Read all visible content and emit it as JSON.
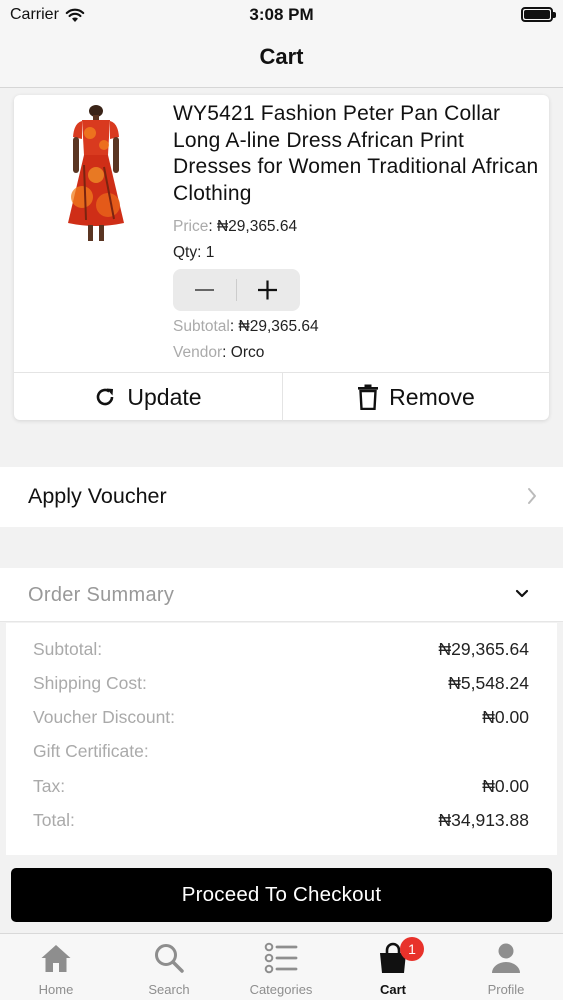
{
  "status_bar": {
    "carrier": "Carrier",
    "time": "3:08 PM"
  },
  "nav": {
    "title": "Cart"
  },
  "cart_item": {
    "title": "WY5421 Fashion Peter Pan Collar Long A-line Dress African Print Dresses for Women Traditional African Clothing",
    "price_label": "Price",
    "price_value": "₦29,365.64",
    "qty_text": "Qty: 1",
    "subtotal_label": "Subtotal",
    "subtotal_value": "₦29,365.64",
    "vendor_label": "Vendor",
    "vendor_value": "Orco",
    "update_label": "Update",
    "remove_label": "Remove"
  },
  "voucher": {
    "label": "Apply Voucher"
  },
  "order_summary": {
    "title": "Order Summary",
    "rows": [
      {
        "label": "Subtotal:",
        "value": "₦29,365.64"
      },
      {
        "label": "Shipping Cost:",
        "value": "₦5,548.24"
      },
      {
        "label": "Voucher Discount:",
        "value": "₦0.00"
      },
      {
        "label": "Gift Certificate:",
        "value": ""
      },
      {
        "label": "Tax:",
        "value": "₦0.00"
      },
      {
        "label": "Total:",
        "value": "₦34,913.88"
      }
    ]
  },
  "checkout": {
    "label": "Proceed To Checkout"
  },
  "tabs": [
    {
      "label": "Home",
      "icon": "home-icon"
    },
    {
      "label": "Search",
      "icon": "search-icon"
    },
    {
      "label": "Categories",
      "icon": "list-icon"
    },
    {
      "label": "Cart",
      "icon": "shopping-bag-icon",
      "badge": "1",
      "active": true
    },
    {
      "label": "Profile",
      "icon": "person-icon"
    }
  ],
  "colors": {
    "badge": "#e8322b",
    "checkout_bg": "#000000",
    "inactive_tab": "#8e8e8e"
  }
}
